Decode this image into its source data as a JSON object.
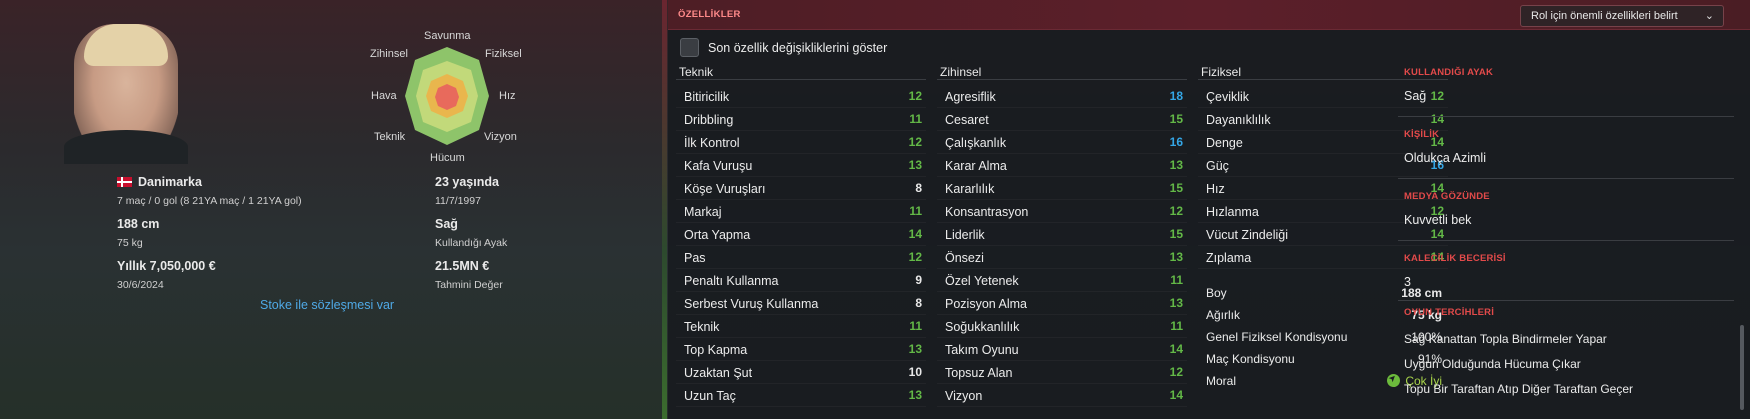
{
  "colors": {
    "green": "#63b847",
    "blue": "#34a6e6",
    "white": "#e8e8e8",
    "accent_red": "#e24a4a",
    "link_blue": "#4fa9e6"
  },
  "radar": {
    "labels": [
      "Savunma",
      "Fiziksel",
      "Hız",
      "Vizyon",
      "Hücum",
      "Teknik",
      "Hava",
      "Zihinsel"
    ]
  },
  "profile": {
    "nationality": "Danimarka",
    "caps": "7 maç / 0 gol (8 21YA maç / 1 21YA gol)",
    "age": "23 yaşında",
    "birthdate": "11/7/1997",
    "height": "188 cm",
    "weight": "75 kg",
    "foot": "Sağ",
    "foot_label": "Kullandığı Ayak",
    "wage": "Yıllık 7,050,000 €",
    "contract_end": "30/6/2024",
    "value": "21.5MN €",
    "value_label": "Tahmini Değer",
    "contract_link": "Stoke ile sözleşmesi var"
  },
  "attributes_panel": {
    "title": "ÖZELLİKLER",
    "role_select": "Rol için önemli özellikleri belirt",
    "checkbox_label": "Son özellik değişikliklerini göster",
    "columns": [
      {
        "title": "Teknik",
        "items": [
          {
            "name": "Bitiricilik",
            "value": "12",
            "tone": "green"
          },
          {
            "name": "Dribbling",
            "value": "11",
            "tone": "green"
          },
          {
            "name": "İlk Kontrol",
            "value": "12",
            "tone": "green"
          },
          {
            "name": "Kafa Vuruşu",
            "value": "13",
            "tone": "green"
          },
          {
            "name": "Köşe Vuruşları",
            "value": "8",
            "tone": "white"
          },
          {
            "name": "Markaj",
            "value": "11",
            "tone": "green"
          },
          {
            "name": "Orta Yapma",
            "value": "14",
            "tone": "green"
          },
          {
            "name": "Pas",
            "value": "12",
            "tone": "green"
          },
          {
            "name": "Penaltı Kullanma",
            "value": "9",
            "tone": "white"
          },
          {
            "name": "Serbest Vuruş Kullanma",
            "value": "8",
            "tone": "white"
          },
          {
            "name": "Teknik",
            "value": "11",
            "tone": "green"
          },
          {
            "name": "Top Kapma",
            "value": "13",
            "tone": "green"
          },
          {
            "name": "Uzaktan Şut",
            "value": "10",
            "tone": "white"
          },
          {
            "name": "Uzun Taç",
            "value": "13",
            "tone": "green"
          }
        ]
      },
      {
        "title": "Zihinsel",
        "items": [
          {
            "name": "Agresiflik",
            "value": "18",
            "tone": "blue"
          },
          {
            "name": "Cesaret",
            "value": "15",
            "tone": "green"
          },
          {
            "name": "Çalışkanlık",
            "value": "16",
            "tone": "blue"
          },
          {
            "name": "Karar Alma",
            "value": "13",
            "tone": "green"
          },
          {
            "name": "Kararlılık",
            "value": "15",
            "tone": "green"
          },
          {
            "name": "Konsantrasyon",
            "value": "12",
            "tone": "green"
          },
          {
            "name": "Liderlik",
            "value": "15",
            "tone": "green"
          },
          {
            "name": "Önsezi",
            "value": "13",
            "tone": "green"
          },
          {
            "name": "Özel Yetenek",
            "value": "11",
            "tone": "green"
          },
          {
            "name": "Pozisyon Alma",
            "value": "13",
            "tone": "green"
          },
          {
            "name": "Soğukkanlılık",
            "value": "11",
            "tone": "green"
          },
          {
            "name": "Takım Oyunu",
            "value": "14",
            "tone": "green"
          },
          {
            "name": "Topsuz Alan",
            "value": "12",
            "tone": "green"
          },
          {
            "name": "Vizyon",
            "value": "14",
            "tone": "green"
          }
        ]
      },
      {
        "title": "Fiziksel",
        "items": [
          {
            "name": "Çeviklik",
            "value": "12",
            "tone": "green"
          },
          {
            "name": "Dayanıklılık",
            "value": "14",
            "tone": "green"
          },
          {
            "name": "Denge",
            "value": "14",
            "tone": "green"
          },
          {
            "name": "Güç",
            "value": "16",
            "tone": "blue"
          },
          {
            "name": "Hız",
            "value": "14",
            "tone": "green"
          },
          {
            "name": "Hızlanma",
            "value": "12",
            "tone": "green"
          },
          {
            "name": "Vücut Zindeliği",
            "value": "14",
            "tone": "green"
          },
          {
            "name": "Zıplama",
            "value": "14",
            "tone": "green"
          }
        ]
      }
    ],
    "physical_info": [
      {
        "name": "Boy",
        "value": "188 cm"
      },
      {
        "name": "Ağırlık",
        "value": "75 kg"
      },
      {
        "name": "Genel Fiziksel Kondisyonu",
        "value": "100%"
      },
      {
        "name": "Maç Kondisyonu",
        "value": "91%"
      },
      {
        "name": "Moral",
        "value": "Çok İyi"
      }
    ],
    "side": {
      "foot_title": "KULLANDIĞI AYAK",
      "foot_value": "Sağ",
      "personality_title": "KİŞİLİK",
      "personality_value": "Oldukça Azimli",
      "media_title": "MEDYA GÖZÜNDE",
      "media_value": "Kuvvetli bek",
      "gk_title": "KALECİLİK BECERİSİ",
      "gk_value": "3",
      "prefs_title": "OYUN TERCİHLERİ",
      "prefs": [
        "Sağ Kanattan Topla Bindirmeler Yapar",
        "Uygun Olduğunda Hücuma Çıkar",
        "Topu Bir Taraftan Atıp Diğer Taraftan Geçer"
      ]
    }
  }
}
